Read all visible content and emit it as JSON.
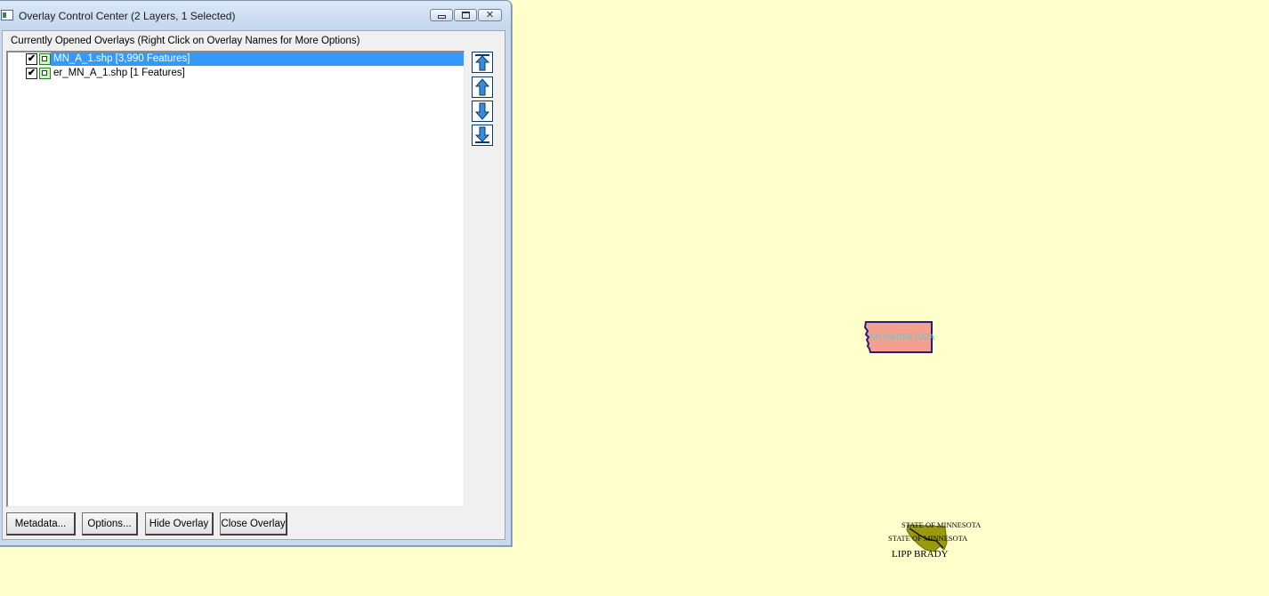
{
  "window": {
    "title": "Overlay Control Center (2 Layers, 1 Selected)",
    "close_glyph": "✕"
  },
  "overlays": {
    "group_label": "Currently Opened Overlays (Right Click on Overlay Names for More Options)",
    "items": [
      {
        "checked_glyph": "✔",
        "label": "MN_A_1.shp [3,990 Features]",
        "selected": true
      },
      {
        "checked_glyph": "✔",
        "label": "er_MN_A_1.shp [1 Features]",
        "selected": false
      }
    ]
  },
  "order_buttons": [
    "move-to-top",
    "move-up",
    "move-down",
    "move-to-bottom"
  ],
  "buttons": {
    "metadata": "Metadata...",
    "options": "Options...",
    "hide": "Hide Overlay",
    "close": "Close Overlay"
  },
  "map": {
    "background": "#ffffcc",
    "parcel_label": "NO OWNER DATA",
    "parcel_fill": "#f4a090",
    "parcel_stroke": "#2a1a7a",
    "label_state_1": "STATE OF MINNESOTA",
    "label_state_2": "STATE OF MINNESOTA",
    "label_owner": "LIPP BRADY",
    "blob_fill": "#9a9a10"
  }
}
